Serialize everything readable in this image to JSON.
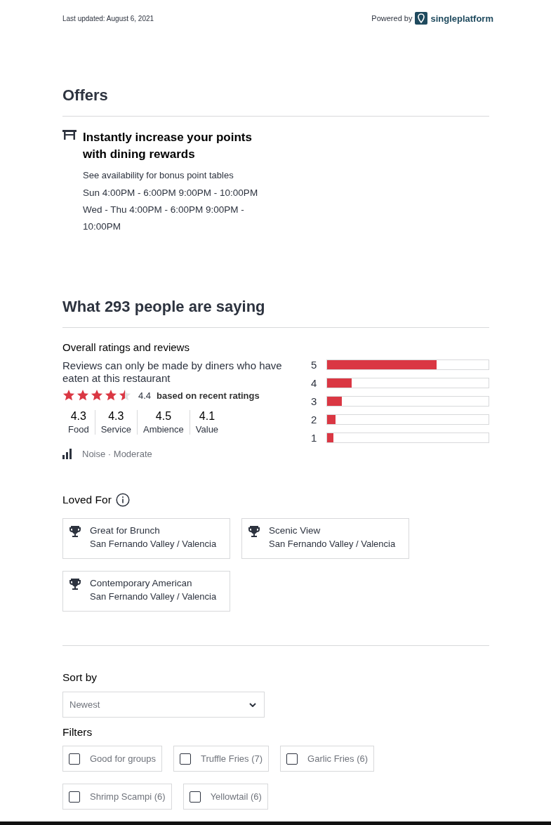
{
  "header": {
    "last_updated": "Last updated: August 6, 2021",
    "powered_by": "Powered by",
    "brand": "singleplatform"
  },
  "offers": {
    "title": "Offers",
    "items": [
      {
        "title": "Instantly increase your points with dining rewards",
        "subtitle": "See availability for bonus point tables",
        "schedule": [
          "Sun 4:00PM - 6:00PM 9:00PM - 10:00PM",
          "Wed - Thu 4:00PM - 6:00PM 9:00PM - 10:00PM"
        ]
      }
    ]
  },
  "reviews": {
    "title": "What 293 people are saying",
    "overall_title": "Overall ratings and reviews",
    "note": "Reviews can only be made by diners who have eaten at this restaurant",
    "stars": 4.5,
    "score": "4.4",
    "score_note": "based on recent ratings",
    "categories": [
      {
        "value": "4.3",
        "label": "Food"
      },
      {
        "value": "4.3",
        "label": "Service"
      },
      {
        "value": "4.5",
        "label": "Ambience"
      },
      {
        "value": "4.1",
        "label": "Value"
      }
    ],
    "noise": {
      "label": "Noise",
      "separator": "·",
      "value": "Moderate"
    },
    "distribution": [
      {
        "label": "5",
        "level": 0.68
      },
      {
        "label": "4",
        "level": 0.15
      },
      {
        "label": "3",
        "level": 0.09
      },
      {
        "label": "2",
        "level": 0.05
      },
      {
        "label": "1",
        "level": 0.04
      }
    ]
  },
  "loved_for": {
    "title": "Loved For",
    "items": [
      {
        "title": "Great for Brunch",
        "area": "San Fernando Valley / Valencia"
      },
      {
        "title": "Scenic View",
        "area": "San Fernando Valley / Valencia"
      },
      {
        "title": "Contemporary American",
        "area": "San Fernando Valley / Valencia"
      }
    ]
  },
  "sort": {
    "label": "Sort by",
    "value": "Newest"
  },
  "filters": {
    "label": "Filters",
    "items": [
      {
        "label": "Good for groups",
        "checked": false
      },
      {
        "label": "Truffle Fries (7)",
        "checked": false
      },
      {
        "label": "Garlic Fries (6)",
        "checked": false
      },
      {
        "label": "Shrimp Scampi (6)",
        "checked": false
      },
      {
        "label": "Yellowtail (6)",
        "checked": false
      }
    ]
  }
}
